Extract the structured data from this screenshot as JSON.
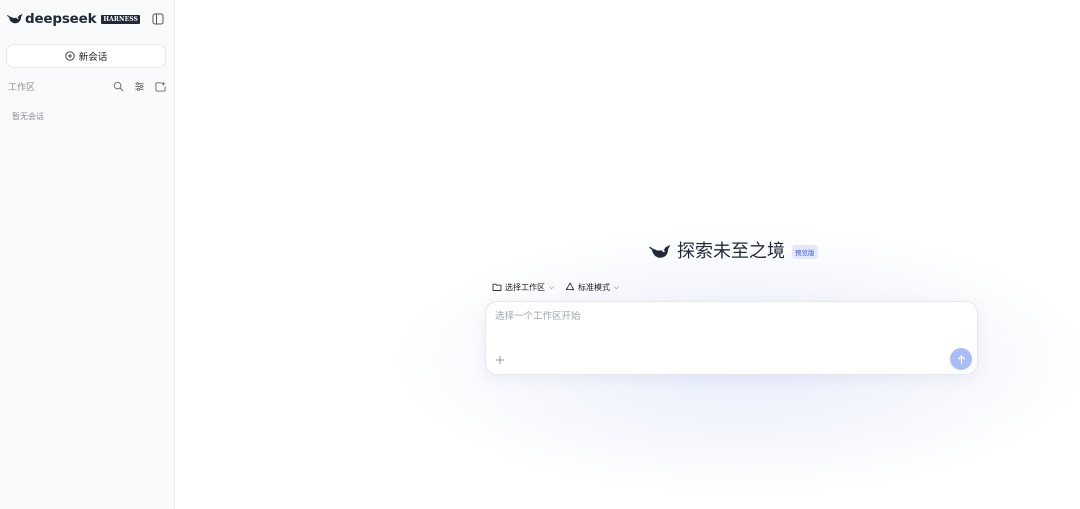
{
  "sidebar": {
    "brand": {
      "name": "deepseek",
      "badge": "HARNESS"
    },
    "new_chat_label": "新会话",
    "workspace": {
      "title": "工作区",
      "empty_text": "暂无会话"
    }
  },
  "main": {
    "hero": {
      "title": "探索未至之境",
      "badge": "预览版"
    },
    "options": {
      "workspace_label": "选择工作区",
      "mode_label": "标准模式"
    },
    "input": {
      "placeholder": "选择一个工作区开始",
      "value": ""
    }
  },
  "colors": {
    "accent": "#a9bdf6",
    "badge_bg": "#e3e9fb",
    "badge_text": "#3b5bdb",
    "brand_dark": "#1f2937"
  },
  "icons": [
    "whale-logo-icon",
    "sidebar-toggle-icon",
    "plus-circle-icon",
    "search-icon",
    "filter-icon",
    "new-folder-icon",
    "folder-icon",
    "chevron-down-icon",
    "recycle-icon",
    "plus-icon",
    "arrow-up-icon"
  ]
}
